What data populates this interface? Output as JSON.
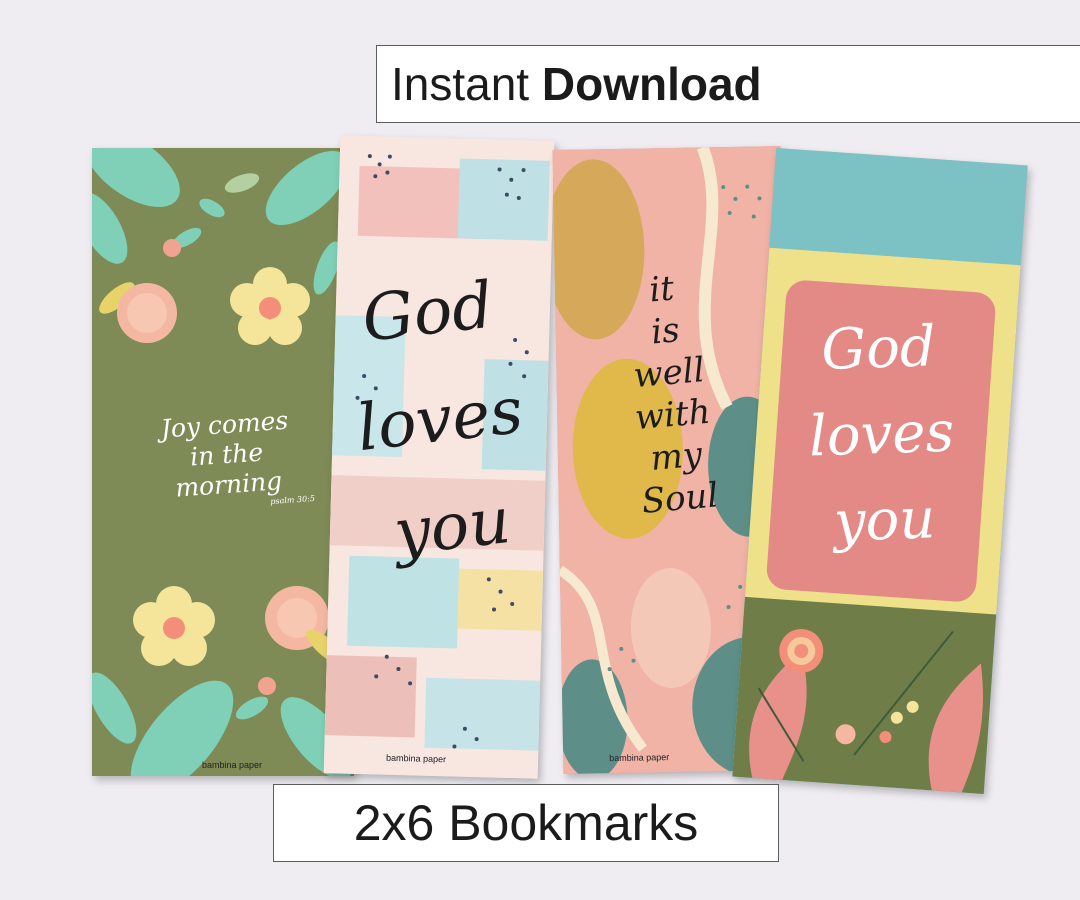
{
  "header": {
    "instant_label": "Instant",
    "download_label": "Download"
  },
  "footer": {
    "product_label": "2x6 Bookmarks"
  },
  "bookmarks": [
    {
      "lines": [
        "Joy comes",
        "in the",
        "morning"
      ],
      "credit": "psalm 30:5",
      "brand": "bambina paper",
      "bg": "#7e8b56"
    },
    {
      "lines": [
        "God",
        "loves",
        "you"
      ],
      "brand": "bambina paper",
      "bg": "#f6e2dc"
    },
    {
      "lines": [
        "it",
        "is",
        "well",
        "with",
        "my",
        "Soul"
      ],
      "brand": "bambina paper",
      "bg": "#e8968f"
    },
    {
      "lines": [
        "God",
        "loves",
        "you"
      ],
      "brand": "",
      "bg": "#7cc1c3"
    }
  ],
  "colors": {
    "background": "#efedf2",
    "olive": "#7e8b56",
    "mint": "#7fd0b7",
    "coral": "#e5857f",
    "teal": "#6fb6b9",
    "yellow": "#efe08a"
  }
}
